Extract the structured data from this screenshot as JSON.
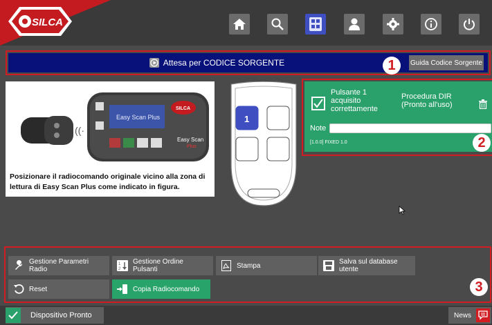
{
  "brand": {
    "logo_text": "SILCA",
    "accent": "#c31b1f"
  },
  "nav": {
    "items": [
      {
        "icon": "home-icon"
      },
      {
        "icon": "search-icon"
      },
      {
        "icon": "remote-list-icon",
        "active": true
      },
      {
        "icon": "user-icon"
      },
      {
        "icon": "gear-icon"
      },
      {
        "icon": "info-icon"
      },
      {
        "icon": "power-icon"
      }
    ]
  },
  "header": {
    "status_text": "Attesa per CODICE SORGENTE",
    "guide_button": "Guida Codice Sorgente",
    "badge": "1"
  },
  "illustration": {
    "device_screen_text": "Easy Scan Plus",
    "device_brand_line1": "Easy Scan",
    "device_brand_line2": "Plus",
    "instruction": "Posizionare il radiocomando originale vicino alla zona di lettura di Easy Scan Plus come indicato in figura."
  },
  "remote": {
    "active_button": "1"
  },
  "result_card": {
    "status_line1": "Pulsante 1",
    "status_line2": "acquisito",
    "status_line3": "correttamente",
    "procedure_line1": "Procedura DIR",
    "procedure_line2": "(Pronto all'uso)",
    "note_label": "Note",
    "note_value": "",
    "code_info": "[1.0.0] FIXED 1.0",
    "badge": "2",
    "color": "#2aa06b"
  },
  "actions": {
    "badge": "3",
    "items": [
      {
        "line1": "Gestione Parametri",
        "line2": "Radio",
        "icon": "wrench-icon"
      },
      {
        "line1": "Gestione Ordine",
        "line2": "Pulsanti",
        "icon": "sort-order-icon"
      },
      {
        "line1": "Stampa",
        "line2": "",
        "icon": "pdf-icon"
      },
      {
        "line1": "Salva sul database",
        "line2": "utente",
        "icon": "save-database-icon"
      },
      {
        "line1": "Reset",
        "line2": "",
        "icon": "reset-icon"
      },
      {
        "line1": "Copia Radiocomando",
        "line2": "",
        "icon": "copy-remote-icon"
      }
    ]
  },
  "statusbar": {
    "ready_text": "Dispositivo Pronto",
    "news_label": "News"
  }
}
